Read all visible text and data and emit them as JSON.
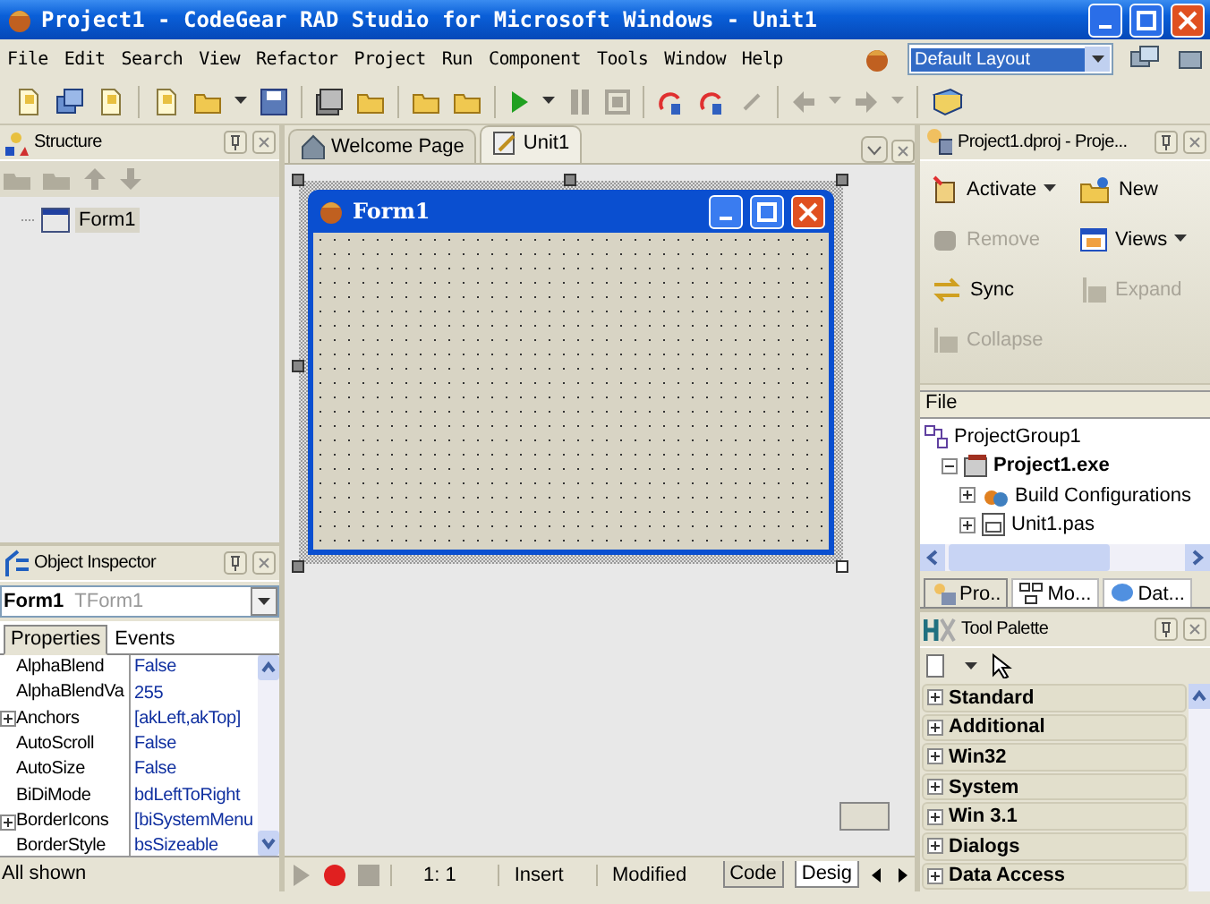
{
  "window": {
    "title": "Project1 - CodeGear RAD Studio for Microsoft Windows - Unit1"
  },
  "menu": [
    "File",
    "Edit",
    "Search",
    "View",
    "Refactor",
    "Project",
    "Run",
    "Component",
    "Tools",
    "Window",
    "Help"
  ],
  "layout_combo": {
    "value": "Default Layout"
  },
  "structure": {
    "title": "Structure",
    "tree": [
      {
        "label": "Form1",
        "selected": true
      }
    ]
  },
  "object_inspector": {
    "title": "Object Inspector",
    "object_name": "Form1",
    "object_type": "TForm1",
    "tabs": [
      {
        "label": "Properties",
        "selected": true
      },
      {
        "label": "Events",
        "selected": false
      }
    ],
    "rows": [
      {
        "name": "AlphaBlend",
        "value": "False",
        "expandable": false
      },
      {
        "name": "AlphaBlendVa",
        "value": "255",
        "expandable": false
      },
      {
        "name": "Anchors",
        "value": "[akLeft,akTop]",
        "expandable": true
      },
      {
        "name": "AutoScroll",
        "value": "False",
        "expandable": false
      },
      {
        "name": "AutoSize",
        "value": "False",
        "expandable": false
      },
      {
        "name": "BiDiMode",
        "value": "bdLeftToRight",
        "expandable": false
      },
      {
        "name": "BorderIcons",
        "value": "[biSystemMenu",
        "expandable": true
      },
      {
        "name": "BorderStyle",
        "value": "bsSizeable",
        "expandable": false
      }
    ],
    "status": "All shown"
  },
  "editor_tabs": [
    {
      "label": "Welcome Page",
      "selected": false
    },
    {
      "label": "Unit1",
      "selected": true
    }
  ],
  "designer": {
    "form_title": "Form1"
  },
  "editor_status": {
    "position": "1:  1",
    "mode": "Insert",
    "state": "Modified",
    "view_tabs": [
      {
        "label": "Code",
        "selected": false
      },
      {
        "label": "Desig",
        "selected": true
      }
    ]
  },
  "project_manager": {
    "title": "Project1.dproj - Proje...",
    "actions": [
      {
        "label": "Activate",
        "kind": "dropdown",
        "disabled": false
      },
      {
        "label": "New",
        "kind": "plain",
        "disabled": false
      },
      {
        "label": "Remove",
        "kind": "plain",
        "disabled": true
      },
      {
        "label": "Views",
        "kind": "dropdown",
        "disabled": false
      },
      {
        "label": "Sync",
        "kind": "plain",
        "disabled": false
      },
      {
        "label": "Expand",
        "kind": "plain",
        "disabled": true
      },
      {
        "label": "Collapse",
        "kind": "plain",
        "disabled": true
      }
    ],
    "column": "File",
    "tree": [
      {
        "label": "ProjectGroup1",
        "bold": false,
        "children": [
          {
            "label": "Project1.exe",
            "bold": true,
            "expanded": true,
            "children": [
              {
                "label": "Build Configurations",
                "bold": false,
                "expanded": false
              },
              {
                "label": "Unit1.pas",
                "bold": false,
                "expanded": false
              }
            ]
          }
        ]
      }
    ],
    "tabs": [
      {
        "label": "Pro..",
        "selected": true
      },
      {
        "label": "Mo...",
        "selected": false
      },
      {
        "label": "Dat...",
        "selected": false
      }
    ]
  },
  "tool_palette": {
    "title": "Tool Palette",
    "categories": [
      "Standard",
      "Additional",
      "Win32",
      "System",
      "Win 3.1",
      "Dialogs",
      "Data Access"
    ]
  }
}
